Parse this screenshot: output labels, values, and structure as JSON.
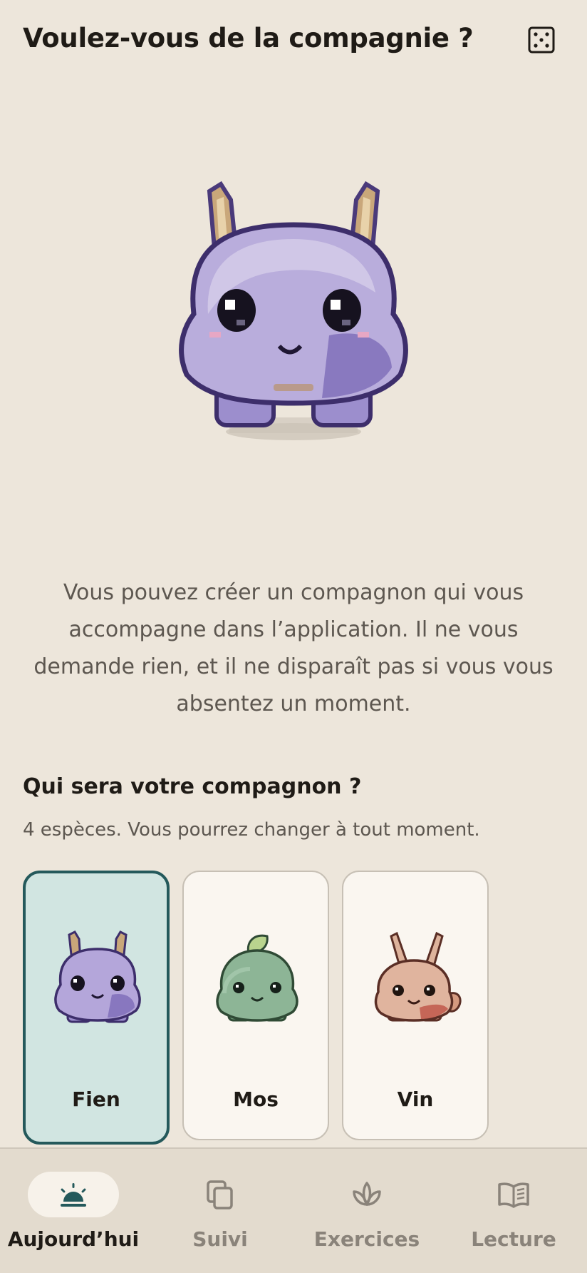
{
  "header": {
    "title": "Voulez-vous de la compagnie ?",
    "dice_icon": "dice-icon"
  },
  "hero": {
    "creature_icon": "creature-fien-illustration"
  },
  "intro": {
    "text": "Vous pouvez créer un compagnon qui vous accompagne dans l’application. Il ne vous demande rien, et il ne disparaît pas si vous vous absentez un moment."
  },
  "species": {
    "title": "Qui sera votre compagnon ?",
    "subtitle": "4 espèces. Vous pourrez changer à tout moment.",
    "cards": [
      {
        "label": "Fien",
        "selected": true,
        "icon": "creature-fien-icon"
      },
      {
        "label": "Mos",
        "selected": false,
        "icon": "creature-mos-icon"
      },
      {
        "label": "Vin",
        "selected": false,
        "icon": "creature-vin-icon"
      }
    ]
  },
  "nav": {
    "items": [
      {
        "label": "Aujourd’hui",
        "icon": "sunrise-icon",
        "active": true
      },
      {
        "label": "Suivi",
        "icon": "cards-icon",
        "active": false
      },
      {
        "label": "Exercices",
        "icon": "lotus-icon",
        "active": false
      },
      {
        "label": "Lecture",
        "icon": "book-icon",
        "active": false
      }
    ]
  },
  "colors": {
    "background": "#EDE6DB",
    "accent": "#24595B",
    "selected_card": "#D1E5E1",
    "card": "#FAF6F0",
    "nav_bg": "#E3DBCE",
    "fien_body": "#A497CF",
    "mos_body": "#7FA98A",
    "vin_body": "#D99C86"
  }
}
